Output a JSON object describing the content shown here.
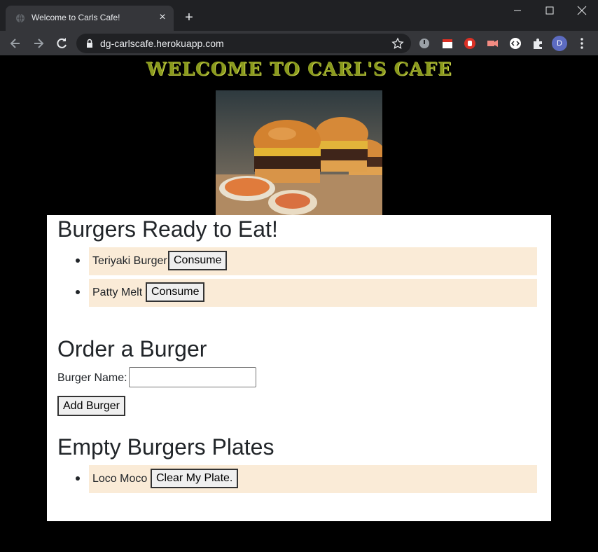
{
  "browser": {
    "tab_title": "Welcome to Carls Cafe!",
    "url": "dg-carlscafe.herokuapp.com",
    "profile_initial": "D",
    "colors": {
      "frame": "#202124",
      "toolbar": "#35363a",
      "text": "#e8eaed"
    }
  },
  "page": {
    "title": "WELCOME TO CARL'S CAFE",
    "hero_alt": "burgers",
    "ready": {
      "heading": "Burgers Ready to Eat!",
      "items": [
        {
          "name": "Teriyaki Burger",
          "button": "Consume"
        },
        {
          "name": "Patty Melt",
          "button": "Consume"
        }
      ]
    },
    "order": {
      "heading": "Order a Burger",
      "label": "Burger Name:",
      "input_value": "",
      "button": "Add Burger"
    },
    "eaten": {
      "heading": "Empty Burgers Plates",
      "items": [
        {
          "name": "Loco Moco",
          "button": "Clear My Plate."
        }
      ]
    },
    "colors": {
      "title": "#8a9a1e",
      "row_bg": "#faebd7",
      "panel_bg": "#ffffff",
      "page_bg": "#000000"
    }
  }
}
